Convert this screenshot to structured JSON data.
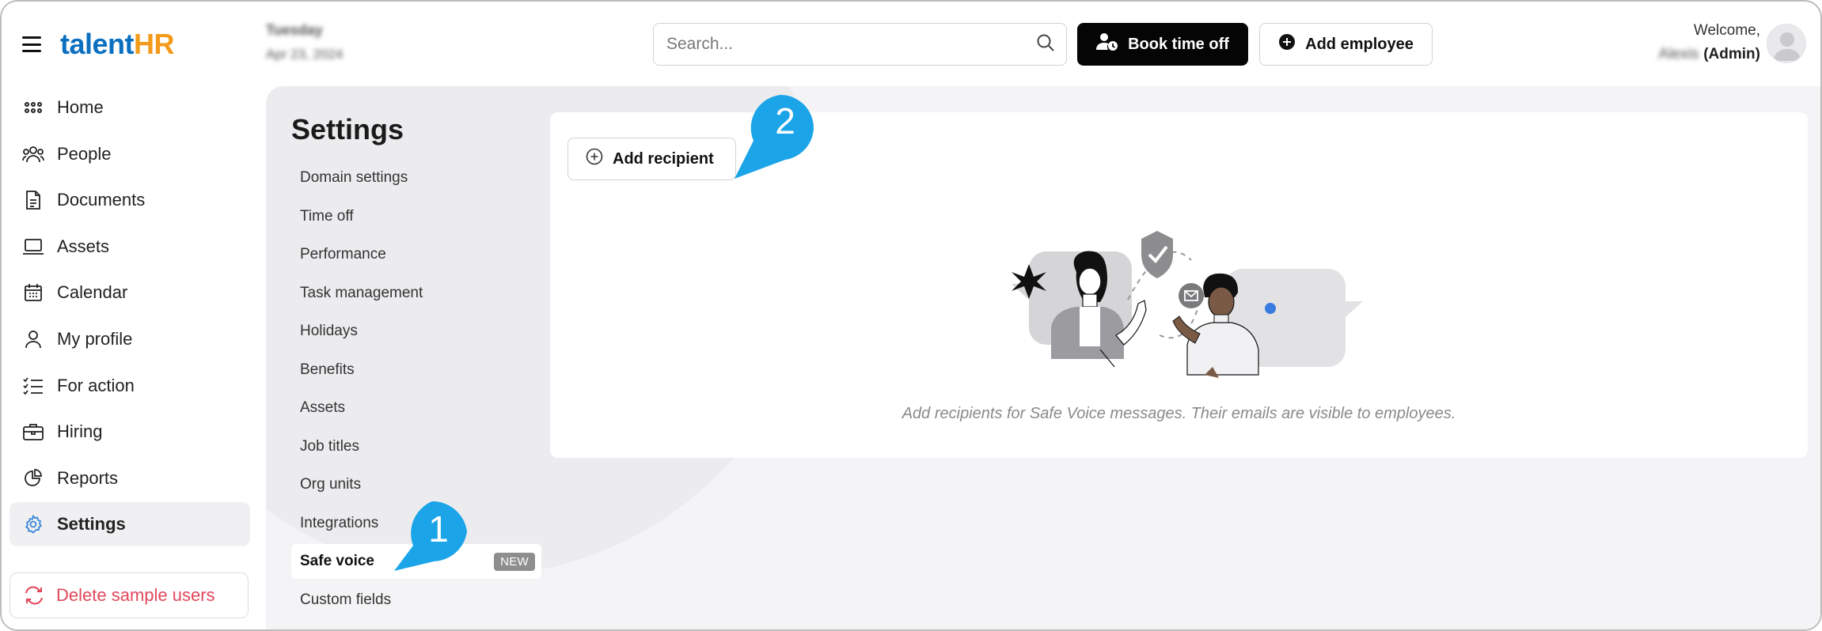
{
  "brand": {
    "logo_prefix": "talent",
    "logo_suffix": "HR"
  },
  "nav": {
    "items": [
      {
        "label": "Home",
        "icon": "grid-icon"
      },
      {
        "label": "People",
        "icon": "people-icon"
      },
      {
        "label": "Documents",
        "icon": "document-icon"
      },
      {
        "label": "Assets",
        "icon": "laptop-icon"
      },
      {
        "label": "Calendar",
        "icon": "calendar-icon"
      },
      {
        "label": "My profile",
        "icon": "user-icon"
      },
      {
        "label": "For action",
        "icon": "checklist-icon"
      },
      {
        "label": "Hiring",
        "icon": "briefcase-icon"
      },
      {
        "label": "Reports",
        "icon": "pie-chart-icon"
      },
      {
        "label": "Settings",
        "icon": "gear-icon",
        "active": true
      }
    ],
    "delete_sample_label": "Delete sample users"
  },
  "header": {
    "date_day": "Tuesday",
    "date_full": "Apr 23, 2024",
    "search_placeholder": "Search...",
    "book_time_off_label": "Book time off",
    "add_employee_label": "Add employee",
    "welcome_label": "Welcome,",
    "user_name": "Alexis",
    "user_role": "(Admin)"
  },
  "settings": {
    "title": "Settings",
    "items": [
      "Domain settings",
      "Time off",
      "Performance",
      "Task management",
      "Holidays",
      "Benefits",
      "Assets",
      "Job titles",
      "Org units",
      "Integrations",
      "Safe voice",
      "Custom fields"
    ],
    "active_item": "Safe voice",
    "active_badge": "NEW"
  },
  "safe_voice": {
    "add_recipient_label": "Add recipient",
    "empty_message": "Add recipients for Safe Voice messages. Their emails are visible to employees."
  },
  "callouts": {
    "one": "1",
    "two": "2"
  },
  "colors": {
    "brand_blue": "#0b6fc0",
    "brand_orange": "#f39a1a",
    "callout_blue": "#1ba4e8",
    "danger": "#e0475b",
    "active_icon": "#3a86d8"
  }
}
